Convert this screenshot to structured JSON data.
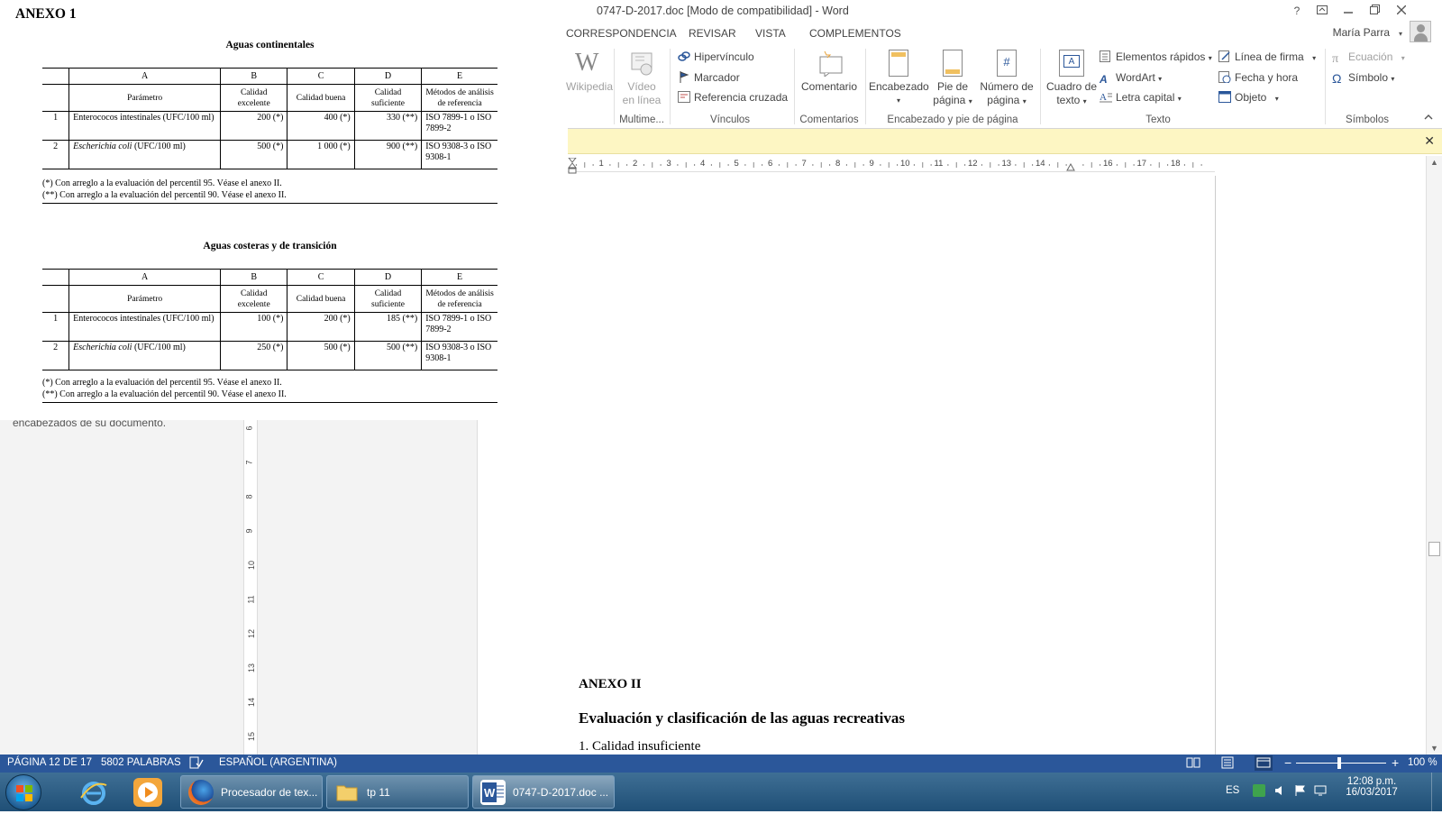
{
  "window": {
    "title": "0747-D-2017.doc [Modo de compatibilidad] - Word",
    "help": "?",
    "user": "María Parra"
  },
  "tabs": [
    "CORRESPONDENCIA",
    "REVISAR",
    "VISTA",
    "COMPLEMENTOS"
  ],
  "ribbon": {
    "wikipedia": "Wikipedia",
    "video_line1": "Vídeo",
    "video_line2": "en línea",
    "hipervinculo": "Hipervínculo",
    "marcador": "Marcador",
    "referencia": "Referencia cruzada",
    "comentario": "Comentario",
    "encabezado": "Encabezado",
    "pie_line1": "Pie de",
    "pie_line2": "página",
    "numero_line1": "Número de",
    "numero_line2": "página",
    "cuadro_line1": "Cuadro de",
    "cuadro_line2": "texto",
    "elementos": "Elementos rápidos",
    "wordart": "WordArt",
    "letra": "Letra capital",
    "linea_firma": "Línea de firma",
    "fecha": "Fecha y hora",
    "objeto": "Objeto",
    "ecuacion": "Ecuación",
    "simbolo": "Símbolo",
    "groups": {
      "multimedia": "Multime...",
      "vinculos": "Vínculos",
      "comentarios": "Comentarios",
      "encabezado_pie": "Encabezado y pie de página",
      "texto": "Texto",
      "simbolos": "Símbolos"
    }
  },
  "ruler_numbers": [
    "1",
    "2",
    "3",
    "4",
    "5",
    "6",
    "7",
    "8",
    "9",
    "10",
    "11",
    "12",
    "13",
    "14",
    "16",
    "17",
    "18"
  ],
  "document": {
    "annex2": "ANEXO II",
    "section_title": "Evaluación y clasificación de las aguas recreativas",
    "first_item": "1. Calidad insuficiente"
  },
  "left_pane": {
    "nav_text": "encabezados de su documento.",
    "vruler_numbers": [
      "6",
      "7",
      "8",
      "9",
      "10",
      "11",
      "12",
      "13",
      "14",
      "15"
    ]
  },
  "snip": {
    "annex": "ANEXO 1",
    "tables": [
      {
        "title": "Aguas continentales",
        "letters": [
          "A",
          "B",
          "C",
          "D",
          "E"
        ],
        "headers": [
          "Parámetro",
          "Calidad excelente",
          "Calidad buena",
          "Calidad suficiente",
          "Métodos de análisis de referencia"
        ],
        "rows": [
          {
            "idx": "1",
            "param": "Enterococos intestinales (UFC/100 ml)",
            "b": "200 (*)",
            "c": "400 (*)",
            "d": "330 (**)",
            "e": "ISO 7899-1 o ISO 7899-2"
          },
          {
            "idx": "2",
            "param_italic": "Escherichia coli",
            "param": " (UFC/100 ml)",
            "b": "500 (*)",
            "c": "1 000 (*)",
            "d": "900 (**)",
            "e": "ISO 9308-3 o ISO 9308-1"
          }
        ],
        "notes": [
          "(*)  Con arreglo a la evaluación del percentil 95. Véase el anexo II.",
          "(**) Con arreglo a la evaluación del percentil 90. Véase el anexo II."
        ]
      },
      {
        "title": "Aguas costeras y de transición",
        "letters": [
          "A",
          "B",
          "C",
          "D",
          "E"
        ],
        "headers": [
          "Parámetro",
          "Calidad excelente",
          "Calidad buena",
          "Calidad suficiente",
          "Métodos de análisis de referencia"
        ],
        "rows": [
          {
            "idx": "1",
            "param": "Enterococos intestinales (UFC/100 ml)",
            "b": "100 (*)",
            "c": "200 (*)",
            "d": "185 (**)",
            "e": "ISO 7899-1 o ISO 7899-2"
          },
          {
            "idx": "2",
            "param_italic": "Escherichia coli",
            "param": " (UFC/100 ml)",
            "b": "250 (*)",
            "c": "500 (*)",
            "d": "500 (**)",
            "e": "ISO 9308-3 o ISO 9308-1"
          }
        ],
        "notes": [
          "(*)  Con arreglo a la evaluación del percentil 95. Véase el anexo II.",
          "(**) Con arreglo a la evaluación del percentil 90. Véase el anexo II."
        ]
      }
    ]
  },
  "status": {
    "page": "PÁGINA 12 DE 17",
    "words": "5802 PALABRAS",
    "language": "ESPAÑOL (ARGENTINA)",
    "zoom": "100 %"
  },
  "taskbar": {
    "apps": [
      "Procesador de tex...",
      "tp 11",
      "0747-D-2017.doc ..."
    ],
    "lang": "ES",
    "time": "12:08 p.m.",
    "date": "16/03/2017"
  },
  "colors": {
    "status_bar": "#2b579a",
    "message_bar": "#fdf6c3",
    "taskbar": "#2a5a82"
  }
}
